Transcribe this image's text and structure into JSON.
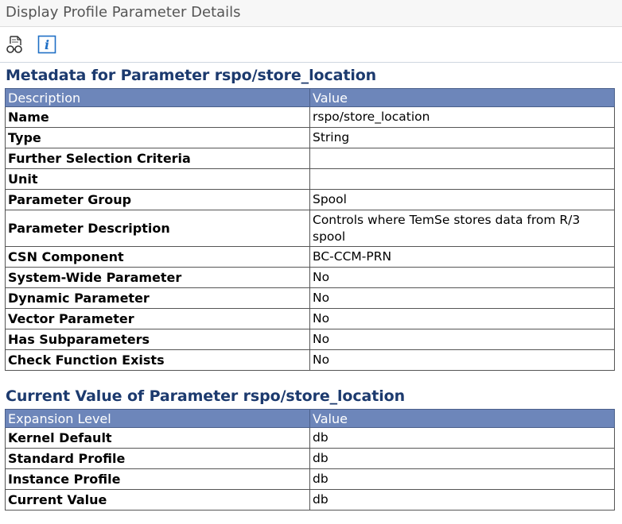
{
  "window": {
    "title": "Display Profile Parameter Details"
  },
  "toolbar": {
    "icons": [
      "documentation-glasses-icon",
      "info-icon"
    ]
  },
  "metadata": {
    "title": "Metadata for Parameter rspo/store_location",
    "columns": [
      "Description",
      "Value"
    ],
    "rows": [
      {
        "label": "Name",
        "value": "rspo/store_location"
      },
      {
        "label": "Type",
        "value": "String"
      },
      {
        "label": "Further Selection Criteria",
        "value": ""
      },
      {
        "label": "Unit",
        "value": ""
      },
      {
        "label": "Parameter Group",
        "value": "Spool"
      },
      {
        "label": "Parameter Description",
        "value": "Controls where TemSe stores data from R/3 spool"
      },
      {
        "label": "CSN Component",
        "value": "BC-CCM-PRN"
      },
      {
        "label": "System-Wide Parameter",
        "value": "No"
      },
      {
        "label": "Dynamic Parameter",
        "value": "No"
      },
      {
        "label": "Vector Parameter",
        "value": "No"
      },
      {
        "label": "Has Subparameters",
        "value": "No"
      },
      {
        "label": "Check Function Exists",
        "value": "No"
      }
    ]
  },
  "current_value": {
    "title": "Current Value of Parameter rspo/store_location",
    "columns": [
      "Expansion Level",
      "Value"
    ],
    "rows": [
      {
        "label": "Kernel Default",
        "value": "db"
      },
      {
        "label": "Standard Profile",
        "value": "db"
      },
      {
        "label": "Instance Profile",
        "value": "db"
      },
      {
        "label": "Current Value",
        "value": "db"
      }
    ]
  },
  "colors": {
    "header_bg": "#6d86ba",
    "section_title": "#1c3a6e",
    "info_icon": "#1f6fc5"
  }
}
